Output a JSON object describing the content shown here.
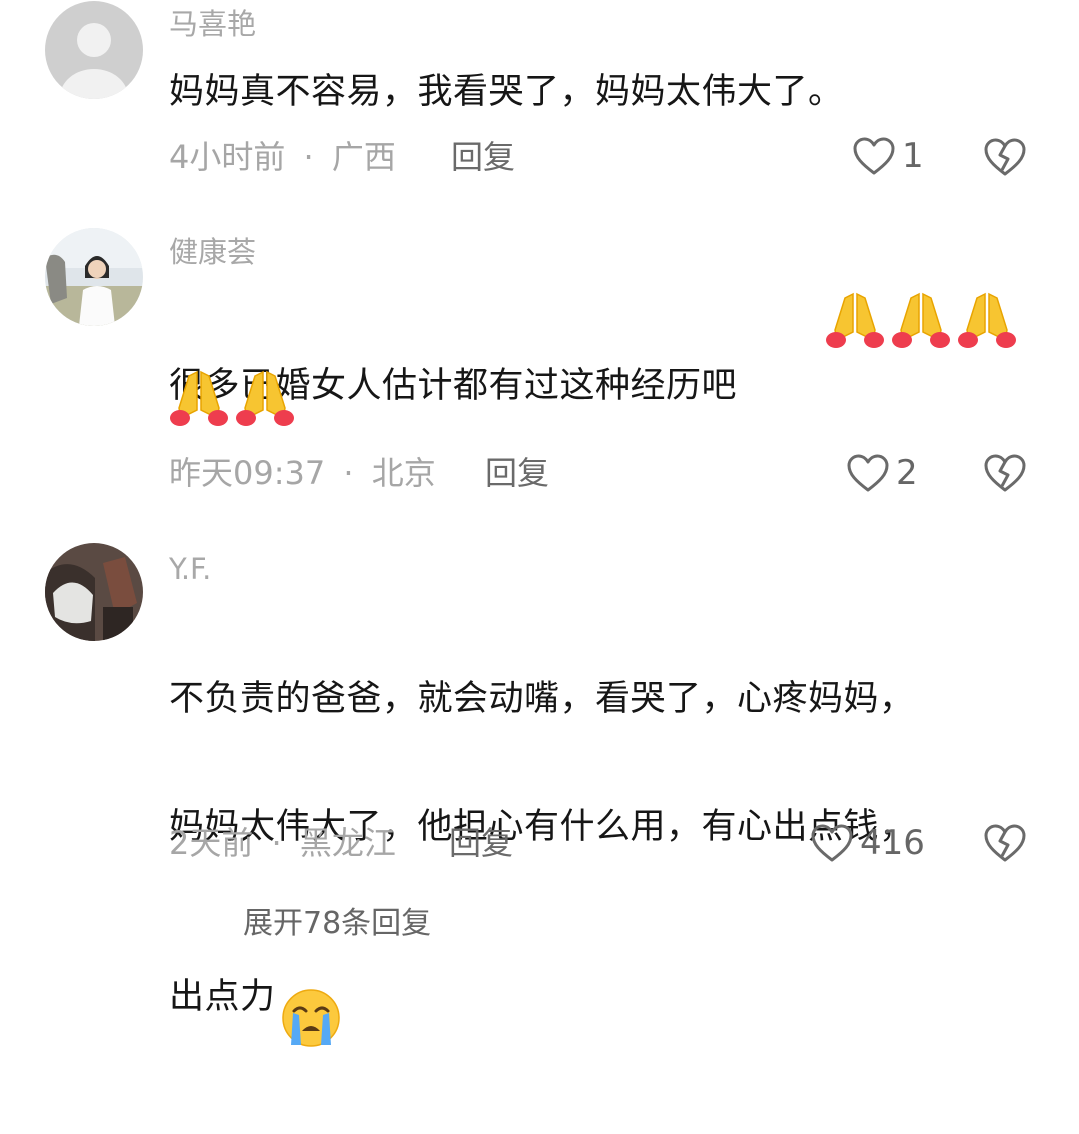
{
  "comments": [
    {
      "username": "马喜艳",
      "text": "妈妈真不容易，我看哭了，妈妈太伟大了。",
      "time": "4小时前",
      "location": "广西",
      "reply_label": "回复",
      "likes": "1"
    },
    {
      "username": "健康荟",
      "text": "很多已婚女人估计都有过这种经历吧",
      "time": "昨天09:37",
      "location": "北京",
      "reply_label": "回复",
      "likes": "2"
    },
    {
      "username": "Y.F.",
      "text_lines": [
        "不负责的爸爸，就会动嘴，看哭了，心疼妈妈，",
        "妈妈太伟大了，他担心有什么用，有心出点钱，",
        "出点力"
      ],
      "time": "2天前",
      "location": "黑龙江",
      "reply_label": "回复",
      "likes": "416"
    }
  ],
  "footer": {
    "more_replies": "展开78条回复"
  },
  "meta_separator": "·",
  "icons": [
    "heart-outline-icon",
    "broken-heart-icon",
    "folded-hands-emoji",
    "crying-face-emoji"
  ]
}
